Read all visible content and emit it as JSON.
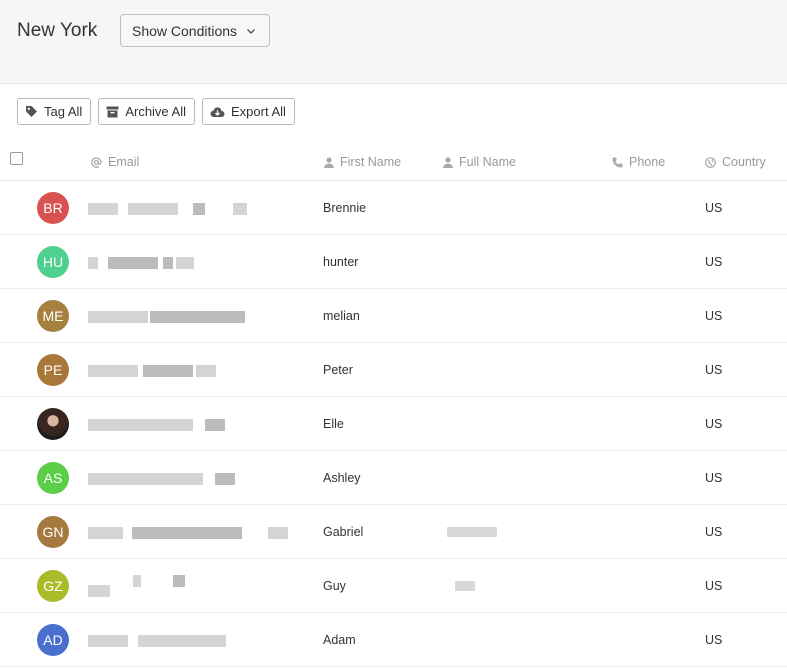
{
  "header": {
    "title": "New York",
    "conditions_label": "Show Conditions"
  },
  "toolbar": {
    "tag_all": "Tag All",
    "archive_all": "Archive All",
    "export_all": "Export All"
  },
  "columns": {
    "email": "Email",
    "first_name": "First Name",
    "full_name": "Full Name",
    "phone": "Phone",
    "country": "Country"
  },
  "rows": [
    {
      "initials": "BR",
      "color": "#d95252",
      "first_name": "Brennie",
      "country": "US"
    },
    {
      "initials": "HU",
      "color": "#4fd08e",
      "first_name": "hunter",
      "country": "US"
    },
    {
      "initials": "ME",
      "color": "#a6803f",
      "first_name": "melian",
      "country": "US"
    },
    {
      "initials": "PE",
      "color": "#a8783a",
      "first_name": "Peter",
      "country": "US"
    },
    {
      "initials": "",
      "color": "#2b2b2b",
      "first_name": "Elle",
      "country": "US",
      "photo": true
    },
    {
      "initials": "AS",
      "color": "#5bcd46",
      "first_name": "Ashley",
      "country": "US"
    },
    {
      "initials": "GN",
      "color": "#a67a3f",
      "first_name": "Gabriel",
      "country": "US"
    },
    {
      "initials": "GZ",
      "color": "#aabb2a",
      "first_name": "Guy",
      "country": "US"
    },
    {
      "initials": "AD",
      "color": "#4b6fcf",
      "first_name": "Adam",
      "country": "US"
    }
  ]
}
